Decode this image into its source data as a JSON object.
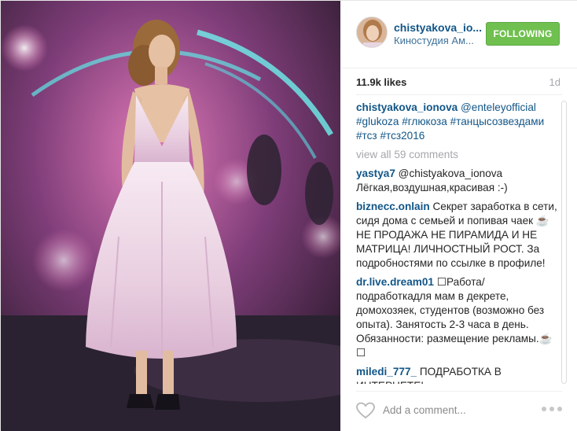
{
  "post": {
    "username": "chistyakova_io...",
    "location": "Киностудия Ам...",
    "follow_label": "FOLLOWING",
    "likes": "11.9k likes",
    "time": "1d",
    "caption": {
      "user": "chistyakova_ionova",
      "mention": "@enteleyofficial",
      "tags": "#glukoza #глюкоза #танцысозвездами #тсз #тсз2016"
    },
    "view_all": "view all 59 comments",
    "comments": [
      {
        "user": "yastya7",
        "text": "@chistyakova_ionova Лёгкая,воздушная,красивая :-)"
      },
      {
        "user": "biznecc.onlain",
        "text": "Секрет заработка в сети, сидя дома с семьей и попивая чаек ☕️ НЕ ПРОДАЖА НЕ ПИРАМИДА И НЕ МАТРИЦА! ЛИЧНОСТНЫЙ РОСТ. За подробностями по ссылке в профиле!"
      },
      {
        "user": "dr.live.dream01",
        "text": "☐Работа/подработкадля мам в декрете, домохозяек, студентов (возможно без опыта). Занятость 2-3 часа в день. Обязанности: размещение рекламы.☕️ ☐"
      },
      {
        "user": "miledi_777_",
        "text": "ПОДРАБОТКА В ИНТЕРНЕТЕ!"
      }
    ],
    "comment_placeholder": "Add a comment...",
    "colors": {
      "follow": "#70c050",
      "link": "#125688",
      "muted": "#a5a7aa"
    }
  }
}
